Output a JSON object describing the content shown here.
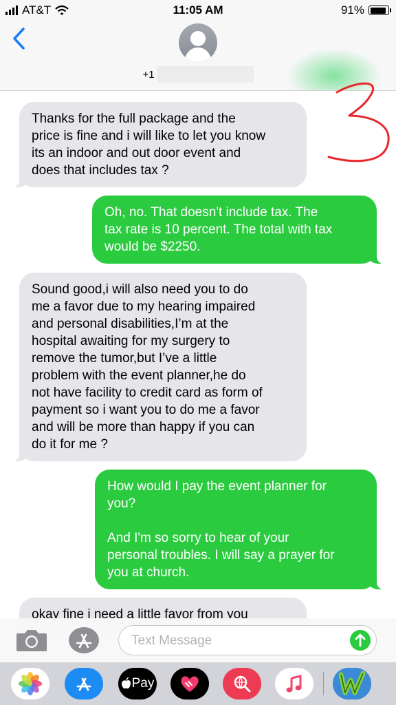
{
  "status_bar": {
    "carrier": "AT&T",
    "time": "11:05 AM",
    "battery": "91%",
    "battery_level": 0.91
  },
  "header": {
    "contact_prefix": "+1",
    "back_icon": "chevron-left-icon",
    "avatar_icon": "person-silhouette-icon"
  },
  "messages": [
    {
      "direction": "incoming",
      "text": "Thanks for the full package and  the\nprice is fine and i will like to let you know\nits an indoor and out door event and\ndoes that includes tax ?"
    },
    {
      "direction": "outgoing",
      "text": "Oh, no. That doesn't include tax. The\ntax rate is 10 percent. The total with tax\nwould be $2250."
    },
    {
      "direction": "incoming",
      "text": "Sound good,i will also need you to do\nme a favor due to my hearing impaired\nand personal disabilities,I’m at the\nhospital awaiting for my surgery to\nremove the tumor,but I’ve a little\nproblem with the event planner,he do\nnot have facility to credit card as form of\npayment so i want you to do me a favor\nand will be more than happy if you can\ndo it for me ?"
    },
    {
      "direction": "outgoing",
      "text": "How would I pay the event planner for\nyou?\n\nAnd I'm so sorry to hear of your\npersonal troubles. I will say a prayer for\nyou at church."
    },
    {
      "direction": "incoming",
      "text": "okay fine i need a little favor from you"
    }
  ],
  "compose": {
    "placeholder": "Text Message",
    "camera_icon": "camera-icon",
    "apps_icon": "app-store-icon",
    "send_icon": "arrow-up-icon"
  },
  "drawer": {
    "apple_pay_label": "Pay",
    "apps": [
      "photos-icon",
      "app-store-icon",
      "apple-pay-icon",
      "digital-touch-icon",
      "web-search-icon",
      "music-icon",
      "game-app-icon"
    ]
  },
  "annotation": {
    "handwritten_mark": "3"
  },
  "colors": {
    "outgoing_bubble": "#2bcb3f",
    "incoming_bubble": "#e5e5ea",
    "accent_blue": "#1a7cf5",
    "annotation_red": "#e8262c"
  }
}
